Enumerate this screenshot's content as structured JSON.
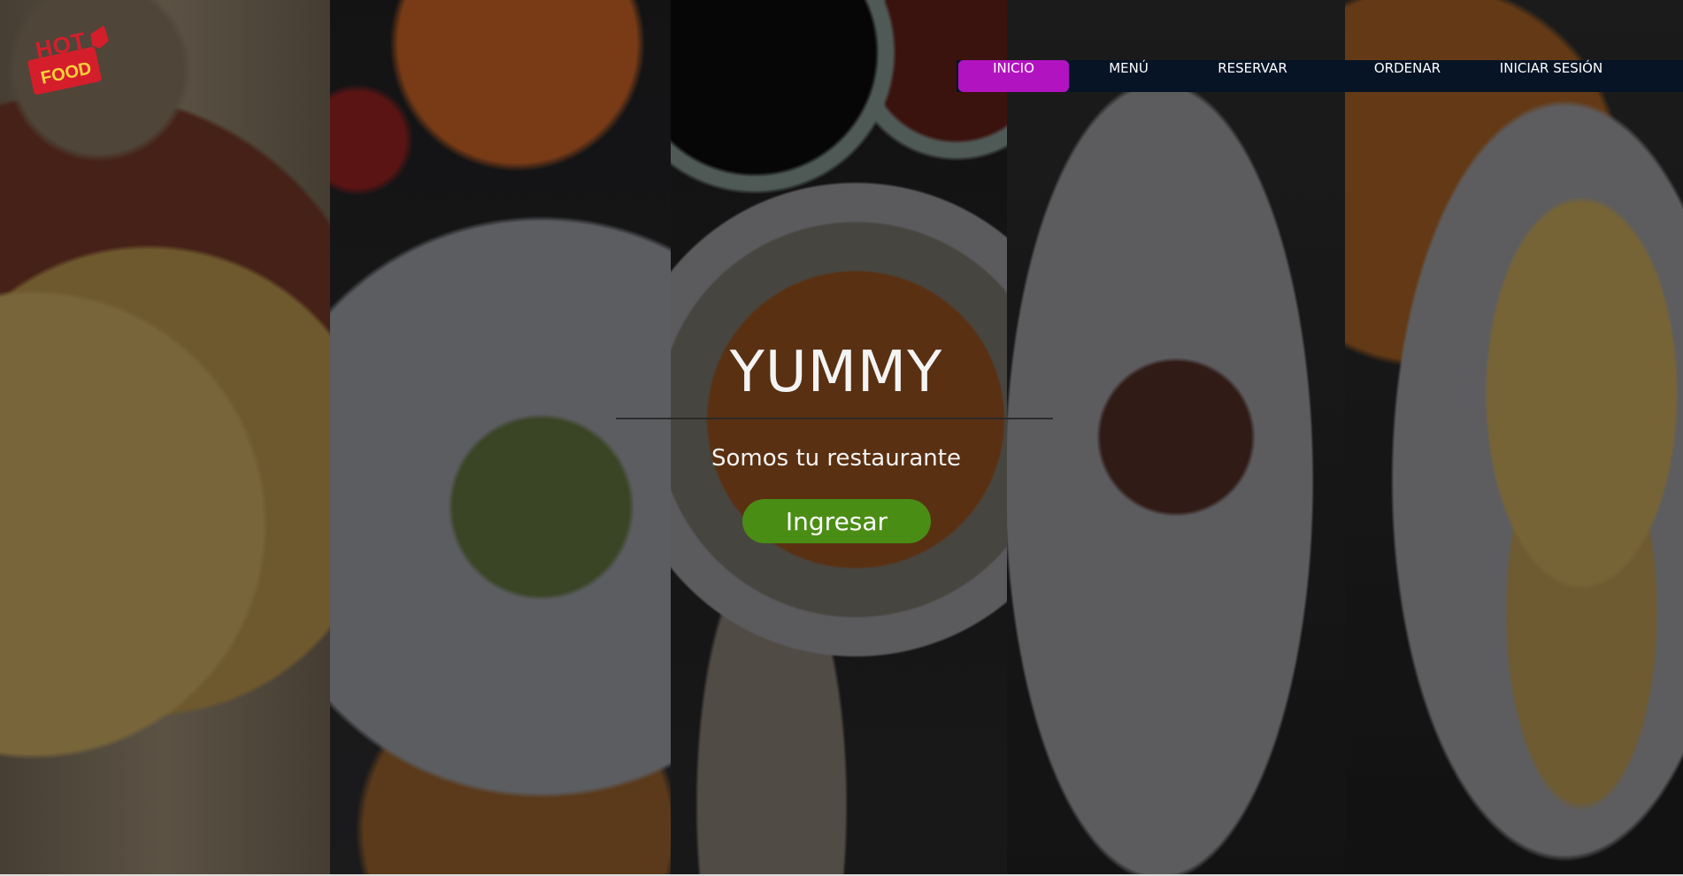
{
  "brand": {
    "logo_top": "HOT",
    "logo_bottom": "FOOD"
  },
  "navbar": {
    "items": [
      {
        "label": "INICIO",
        "active": true
      },
      {
        "label": "MENÚ",
        "active": false
      },
      {
        "label": "RESERVAR",
        "active": false
      },
      {
        "label": "ORDENAR",
        "active": false
      },
      {
        "label": "INICIAR SESIÓN",
        "active": false
      }
    ],
    "active_color": "#b213c0",
    "background_color": "#071426"
  },
  "hero": {
    "title": "YUMMY",
    "subtitle": "Somos tu restaurante",
    "cta_label": "Ingresar",
    "cta_color": "#4a8d14"
  },
  "background_photos": [
    "rice-with-nuts",
    "green-ravioli",
    "noodle-soup",
    "sliced-beef",
    "quiche"
  ]
}
